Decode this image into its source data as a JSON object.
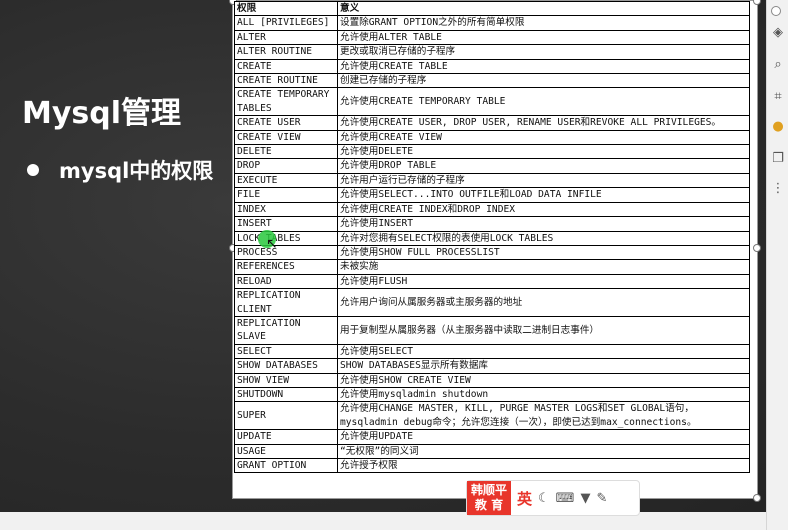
{
  "slide": {
    "title": "Mysql管理",
    "bullet": "mysql中的权限"
  },
  "table": {
    "headers": [
      "权限",
      "意义"
    ],
    "rows": [
      [
        "ALL [PRIVILEGES]",
        "设置除GRANT OPTION之外的所有简单权限"
      ],
      [
        "ALTER",
        "允许使用ALTER TABLE"
      ],
      [
        "ALTER ROUTINE",
        "更改或取消已存储的子程序"
      ],
      [
        "CREATE",
        "允许使用CREATE TABLE"
      ],
      [
        "CREATE ROUTINE",
        "创建已存储的子程序"
      ],
      [
        "CREATE TEMPORARY TABLES",
        "允许使用CREATE TEMPORARY TABLE"
      ],
      [
        "CREATE USER",
        "允许使用CREATE USER, DROP USER, RENAME USER和REVOKE ALL PRIVILEGES。"
      ],
      [
        "CREATE VIEW",
        "允许使用CREATE VIEW"
      ],
      [
        "DELETE",
        "允许使用DELETE"
      ],
      [
        "DROP",
        "允许使用DROP TABLE"
      ],
      [
        "EXECUTE",
        "允许用户运行已存储的子程序"
      ],
      [
        "FILE",
        "允许使用SELECT...INTO OUTFILE和LOAD DATA INFILE"
      ],
      [
        "INDEX",
        "允许使用CREATE INDEX和DROP INDEX"
      ],
      [
        "INSERT",
        "允许使用INSERT"
      ],
      [
        "LOCK TABLES",
        "允许对您拥有SELECT权限的表使用LOCK TABLES"
      ],
      [
        "PROCESS",
        "允许使用SHOW FULL PROCESSLIST"
      ],
      [
        "REFERENCES",
        "未被实施"
      ],
      [
        "RELOAD",
        "允许使用FLUSH"
      ],
      [
        "REPLICATION CLIENT",
        "允许用户询问从属服务器或主服务器的地址"
      ],
      [
        "REPLICATION SLAVE",
        "用于复制型从属服务器（从主服务器中读取二进制日志事件）"
      ],
      [
        "SELECT",
        "允许使用SELECT"
      ],
      [
        "SHOW DATABASES",
        "SHOW DATABASES显示所有数据库"
      ],
      [
        "SHOW VIEW",
        "允许使用SHOW CREATE VIEW"
      ],
      [
        "SHUTDOWN",
        "允许使用mysqladmin shutdown"
      ],
      [
        "SUPER",
        "允许使用CHANGE MASTER, KILL, PURGE MASTER LOGS和SET GLOBAL语句，mysqladmin debug命令；允许您连接（一次），即使已达到max_connections。"
      ],
      [
        "UPDATE",
        "允许使用UPDATE"
      ],
      [
        "USAGE",
        "“无权限”的同义词"
      ],
      [
        "GRANT OPTION",
        "允许授予权限"
      ]
    ]
  },
  "ime": {
    "logo_top": "韩顺平",
    "logo_bottom": "教 育",
    "lang": "英",
    "icons": [
      "moon-icon",
      "keyboard-icon",
      "shirt-icon",
      "wrench-icon"
    ]
  },
  "toolbar_icons": [
    "layers-icon",
    "zoom-icon",
    "crop-icon",
    "bulb-icon",
    "copy-icon",
    "more-icon"
  ],
  "colors": {
    "accent": "#e8352b",
    "cursor": "#28c83c"
  }
}
